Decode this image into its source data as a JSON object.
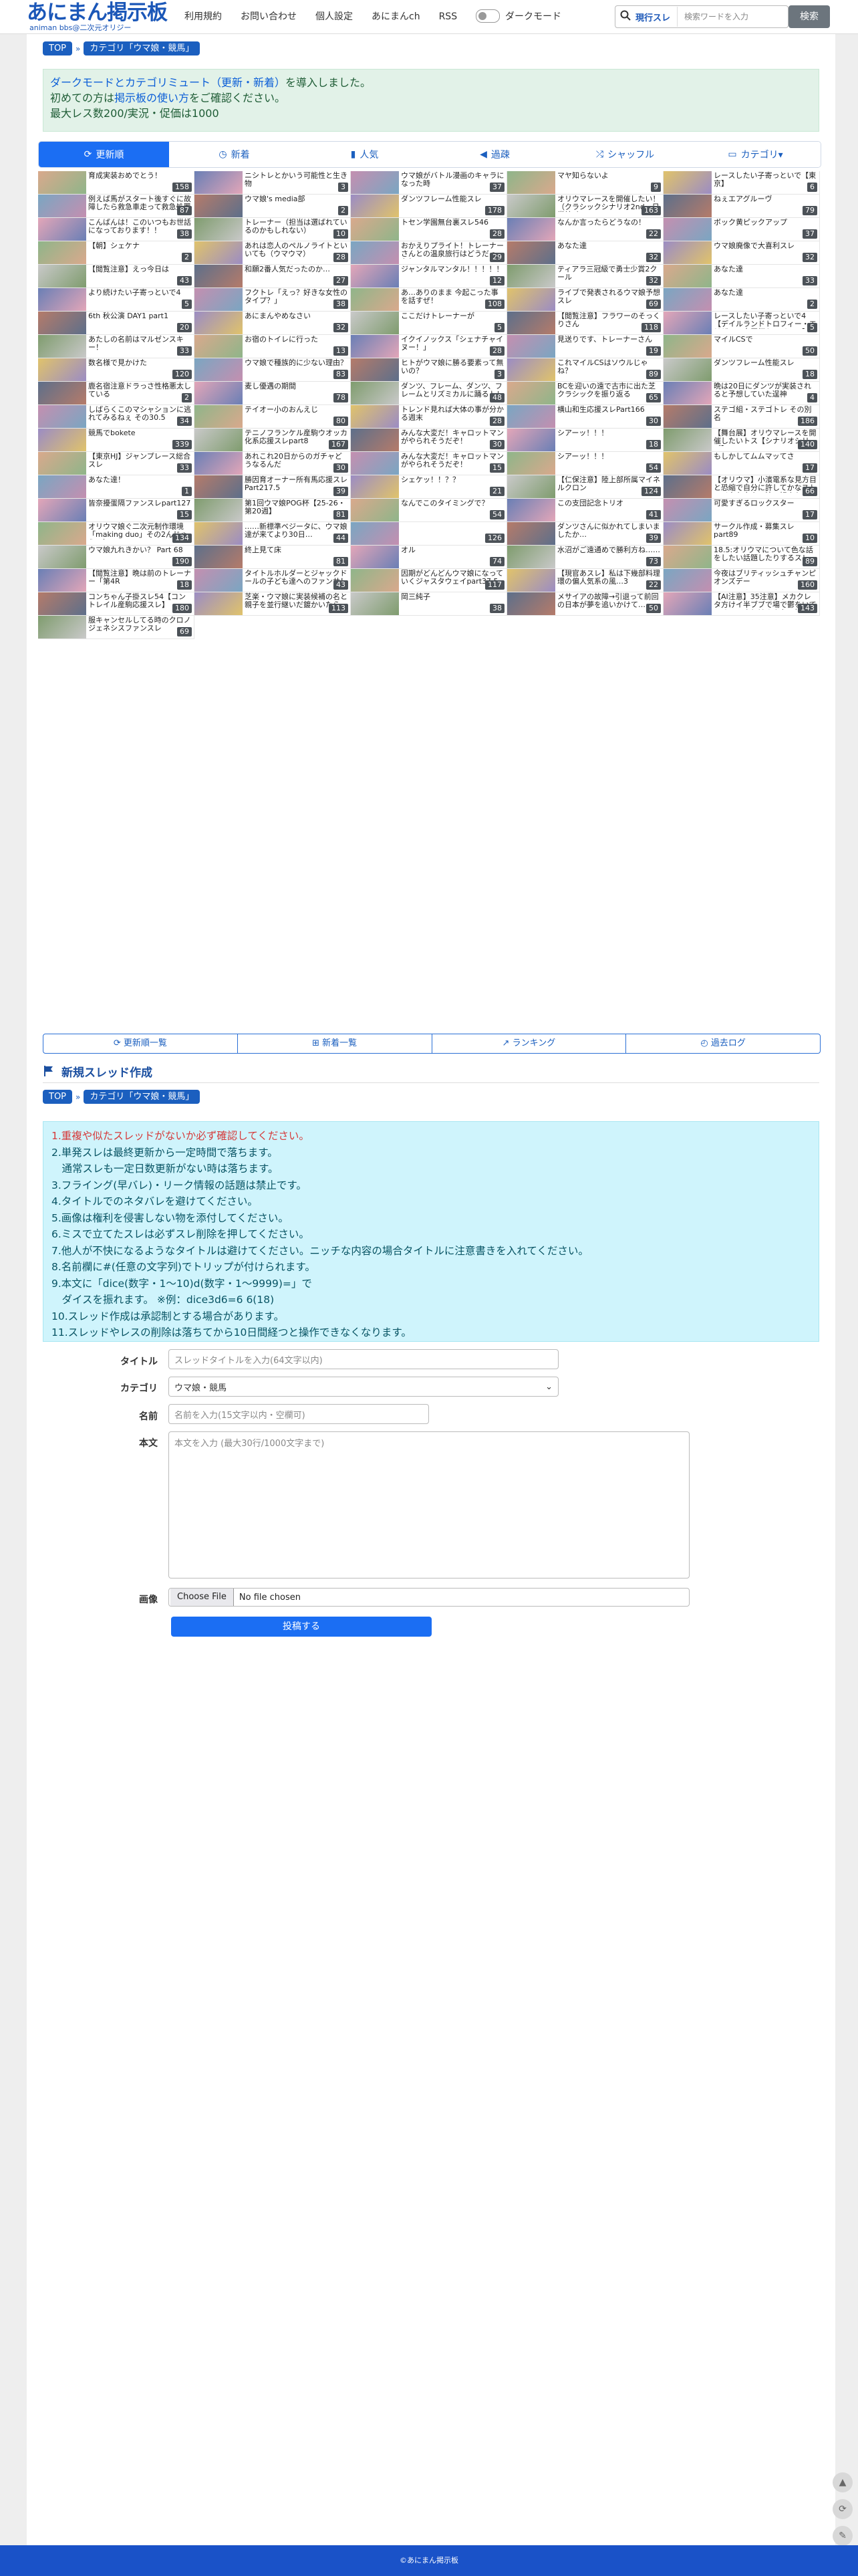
{
  "header": {
    "logo_main": "あにまん掲示板",
    "logo_sub": "animan bbs@二次元オリジー",
    "nav": [
      "利用規約",
      "お問い合わせ",
      "個人設定",
      "あにまんch",
      "RSS"
    ],
    "dark_mode_label": "ダークモード",
    "search_scope": "現行スレ",
    "search_placeholder": "検索ワードを入力",
    "search_button": "検索"
  },
  "breadcrumb": {
    "top": "TOP",
    "sep": "»",
    "category": "カテゴリ「ウマ娘・競馬」"
  },
  "notice": {
    "line1_link": "ダークモードとカテゴリミュート（更新・新着）",
    "line1_rest": "を導入しました。",
    "line2_pre": "初めての方は",
    "line2_link": "掲示板の使い方",
    "line2_rest": "をご確認ください。",
    "line3": "最大レス数200/実況・促価は1000"
  },
  "tabs": [
    {
      "label": "更新順",
      "icon": "refresh-icon"
    },
    {
      "label": "新着",
      "icon": "clock-icon"
    },
    {
      "label": "人気",
      "icon": "bar-chart-icon"
    },
    {
      "label": "過疎",
      "icon": "speaker-icon"
    },
    {
      "label": "シャッフル",
      "icon": "shuffle-icon"
    },
    {
      "label": "カテゴリ▾",
      "icon": "folder-icon"
    }
  ],
  "threads": [
    {
      "title": "育成実装おめでとう！",
      "count": "158"
    },
    {
      "title": "ニシトレとかいう可能性と生き物",
      "count": "3"
    },
    {
      "title": "ウマ娘がバトル漫画のキャラになった時",
      "count": "37"
    },
    {
      "title": "マヤ知らないよ",
      "count": "9"
    },
    {
      "title": "レースしたい子寄っといで【東京】",
      "count": "6"
    },
    {
      "title": "例えば馬がスタート後すぐに故障したら救急車走って救急処置",
      "count": "87"
    },
    {
      "title": "ウマ娘's media部",
      "count": "2"
    },
    {
      "title": "ダンツフレーム性能スレ",
      "count": "178"
    },
    {
      "title": "オリウマレースを開催したい！（クラシックシナリオ2nd・日常編5）",
      "count": "163"
    },
    {
      "title": "ねぇエアグルーヴ",
      "count": "79"
    },
    {
      "title": "こんばんは！このいつもお世話になっております！！",
      "count": "38"
    },
    {
      "title": "トレーナー（担当は選ばれているのかもしれない）",
      "count": "10"
    },
    {
      "title": "トセン学園無台裏スレ546",
      "count": "28"
    },
    {
      "title": "なんか言ったらどうなの！",
      "count": "22"
    },
    {
      "title": "ボック黄ピックアップ",
      "count": "37"
    },
    {
      "title": "【朝】シェケナ",
      "count": "2"
    },
    {
      "title": "あれは恋人のペルノライトといいても（ウマウマ）",
      "count": "28"
    },
    {
      "title": "おかえりプライト！トレーナーさんとの温泉旅行はどうだった？",
      "count": "29"
    },
    {
      "title": "あなた達",
      "count": "32"
    },
    {
      "title": "ウマ娘廃像で大喜利スレ",
      "count": "32"
    },
    {
      "title": "【閲覧注意】えっ今日は",
      "count": "43"
    },
    {
      "title": "和願2番人気だったのか…",
      "count": "27"
    },
    {
      "title": "ジャンタルマンタル！！！！！",
      "count": "12"
    },
    {
      "title": "ティアラ三冠級で勇士少賞2クール",
      "count": "32"
    },
    {
      "title": "あなた達",
      "count": "33"
    },
    {
      "title": "より続けたい子寄っといで4",
      "count": "5"
    },
    {
      "title": "フクトレ「えっ？好きな女性のタイプ？」",
      "count": "38"
    },
    {
      "title": "あ…ありのまま 今起こった事を話すぜ！",
      "count": "108"
    },
    {
      "title": "ライブで発表されるウマ娘予想スレ",
      "count": "69"
    },
    {
      "title": "あなた達",
      "count": "2"
    },
    {
      "title": "6th 秋公演 DAY1 part1",
      "count": "20"
    },
    {
      "title": "あにまんやめなさい",
      "count": "32"
    },
    {
      "title": "ここだけトレーナーが",
      "count": "5"
    },
    {
      "title": "【閲覧注意】フラワーのそっくりさん",
      "count": "118"
    },
    {
      "title": "レースしたい子寄っといで4【デイルランドトロフィー・エリザベス女王杯トライアル】",
      "count": "5"
    },
    {
      "title": "あたしの名前はマルゼンスキー！",
      "count": "33"
    },
    {
      "title": "お宿のトイレに行った",
      "count": "13"
    },
    {
      "title": "イクイノックス「シェナチャイヌー！」",
      "count": "28"
    },
    {
      "title": "見送りです、トレーナーさん",
      "count": "19"
    },
    {
      "title": "マイルCSで",
      "count": "50"
    },
    {
      "title": "数名様で見かけた",
      "count": "120"
    },
    {
      "title": "ウマ娘で種族的に少ない理由？",
      "count": "83"
    },
    {
      "title": "ヒトがウマ娘に勝る要素って無いの？",
      "count": "3"
    },
    {
      "title": "これマイルCSはソウルじゃね？",
      "count": "89"
    },
    {
      "title": "ダンツフレーム性能スレ",
      "count": "18"
    },
    {
      "title": "鹿名宿注意ドラっさ性格悪太している",
      "count": "2"
    },
    {
      "title": "麦し優遇の期間",
      "count": "78"
    },
    {
      "title": "ダンツ、フレーム、ダンツ、フレームとリズミカルに踊るトレ",
      "count": "48"
    },
    {
      "title": "BCを迎いの遠で古市に出た芝クラシックを振り返る",
      "count": "65"
    },
    {
      "title": "晩は20日にダンツが実装されると予想していた逞神",
      "count": "4"
    },
    {
      "title": "しばらくこのマシャションに逃れてみるねぇ その30.5",
      "count": "34"
    },
    {
      "title": "テイオー小のおんえじ",
      "count": "80"
    },
    {
      "title": "トレンド見れば大体の事が分かる週末",
      "count": "28"
    },
    {
      "title": "横山和生応援スレPart166",
      "count": "30"
    },
    {
      "title": "ステゴ組・ステゴトレ その別名",
      "count": "186"
    },
    {
      "title": "競馬でbokete",
      "count": "339"
    },
    {
      "title": "テニノフランケル産駒ウオッカ化系応援スレpart8",
      "count": "167"
    },
    {
      "title": "みんな大変だ！キャロットマンがやられそうだぞ！",
      "count": "30"
    },
    {
      "title": "シアーッ！！！",
      "count": "18"
    },
    {
      "title": "【舞台展】オリウマレースを開催したいトス【シナリオシリーズ】",
      "count": "140"
    },
    {
      "title": "【東京HJ】ジャンプレース総合スレ",
      "count": "33"
    },
    {
      "title": "あれこれ20日からのガチャどうなるんだ",
      "count": "30"
    },
    {
      "title": "みんな大変だ！キャロットマンがやられそうだぞ！",
      "count": "15"
    },
    {
      "title": "シアーッ！！！",
      "count": "54"
    },
    {
      "title": "もしかしてムムマッてさ",
      "count": "17"
    },
    {
      "title": "あなた達！",
      "count": "1"
    },
    {
      "title": "勝因育オーナー所有馬応援スレPart217.5",
      "count": "39"
    },
    {
      "title": "シェケッ！！？？",
      "count": "21"
    },
    {
      "title": "【仁保注意】陸上部所属マイネルクロン",
      "count": "124"
    },
    {
      "title": "【オリウマ】小濱電系な見方目と恐縮で自分に許してかなストライクな中ウマ娘、好きかい？",
      "count": "66"
    },
    {
      "title": "皆奈擾蛋隔ファンスレpart127",
      "count": "15"
    },
    {
      "title": "第1回ウマ娘POG杯【25-26・第20週】",
      "count": "81"
    },
    {
      "title": "なんでこのタイミングで？",
      "count": "54"
    },
    {
      "title": "この支団記念トリオ",
      "count": "41"
    },
    {
      "title": "可愛すぎるロックスター",
      "count": "17"
    },
    {
      "title": "オリウマ娘ぐ二次元制作環境「making duo」その2んじゃう6人",
      "count": "134"
    },
    {
      "title": "……新標準ベジータに、ウマ娘達が来てより30日…",
      "count": "44"
    },
    {
      "title": "",
      "count": "126"
    },
    {
      "title": "ダンツさんに似かれてしまいましたか…",
      "count": "39"
    },
    {
      "title": "サークル作成・募集スレ part89",
      "count": "10"
    },
    {
      "title": "ウマ娘九れきかい？ Part 68",
      "count": "190"
    },
    {
      "title": "終上見て床",
      "count": "81"
    },
    {
      "title": "オル",
      "count": "74"
    },
    {
      "title": "水沼がご遠通めで勝利方ね……",
      "count": "73"
    },
    {
      "title": "18.5:オリウマについて色な話をしたい話題したりするスレ",
      "count": "89"
    },
    {
      "title": "【閲覧注意】晩は前のトレーナー「第4R",
      "count": "18"
    },
    {
      "title": "タイトルホルダーとジャックドールの子ども達へのファンサ！",
      "count": "43"
    },
    {
      "title": "因期がどんどんウマ娘になっていくジャスタウェイpart37.5",
      "count": "117"
    },
    {
      "title": "【現官あスレ】私は下幾部料理環の偏人気系の風…3",
      "count": "22"
    },
    {
      "title": "今夜はブリティッシュチャンピオンズデー",
      "count": "160"
    },
    {
      "title": "コンちゃん子掛スレ54【コントレイル産駒応援スレ】",
      "count": "180"
    },
    {
      "title": "芝楽・ウマ娘に実装候補の名と親子を並行継いだ鍍かいたら",
      "count": "113"
    },
    {
      "title": "岡三純子",
      "count": "38"
    },
    {
      "title": "メサイアの故障→引退って前回の日本が夢を追いかけて…",
      "count": "50"
    },
    {
      "title": "【AI注意】35注意】メカクレタ方けイ半ブブで場で鬱をいていくのでまとはみんなの好きにしてくれ9",
      "count": "143"
    },
    {
      "title": "服キャンセルしてる時のクロノジェネシスファンスレ",
      "count": "69"
    }
  ],
  "subnav": [
    {
      "label": "更新順一覧",
      "icon": "refresh-icon"
    },
    {
      "label": "新着一覧",
      "icon": "new-icon"
    },
    {
      "label": "ランキング",
      "icon": "ranking-icon"
    },
    {
      "label": "過去ログ",
      "icon": "history-icon"
    }
  ],
  "new_thread": {
    "heading": "新規スレッド作成",
    "rules": [
      "1.重複や似たスレッドがないか必ず確認してください。",
      "2.単発スレは最終更新から一定時間で落ちます。",
      "　通常スレも一定日数更新がない時は落ちます。",
      "3.フライング(早バレ)・リーク情報の話題は禁止です。",
      "4.タイトルでのネタバレを避けてください。",
      "5.画像は権利を侵害しない物を添付してください。",
      "6.ミスで立てたスレは必ずスレ削除を押してください。",
      "7.他人が不快になるようなタイトルは避けてください。ニッチな内容の場合タイトルに注意書きを入れてください。",
      "8.名前欄に#(任意の文字列)でトリップが付けられます。",
      "9.本文に「dice(数字・1〜10)d(数字・1〜9999)=」で",
      "　ダイスを振れます。 ※例：dice3d6=6 6(18)",
      "10.スレッド作成は承認制とする場合があります。",
      "11.スレッドやレスの削除は落ちてから10日間経つと操作できなくなります。"
    ],
    "labels": {
      "title": "タイトル",
      "category": "カテゴリ",
      "name": "名前",
      "body": "本文",
      "image": "画像"
    },
    "title_placeholder": "スレッドタイトルを入力(64文字以内)",
    "category_value": "ウマ娘・競馬",
    "name_placeholder": "名前を入力(15文字以内・空欄可)",
    "body_placeholder": "本文を入力 (最大30行/1000文字まで)",
    "file_button": "Choose File",
    "file_status": "No file chosen",
    "submit": "投稿する"
  },
  "footer": {
    "text": "©あにまん掲示板"
  }
}
